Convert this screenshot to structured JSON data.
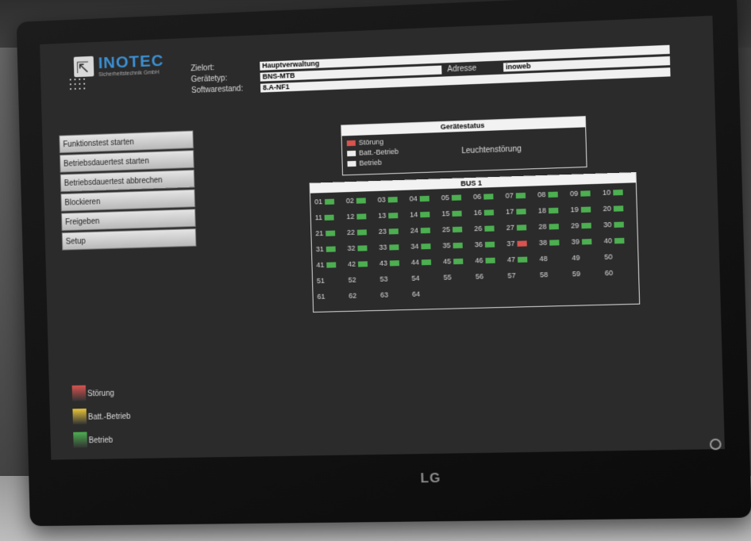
{
  "header": {
    "logo_text": "INOTEC",
    "logo_sub": "Sicherheitstechnik GmbH",
    "zielort_label": "Zielort:",
    "zielort_value": "Hauptverwaltung",
    "geraetetyp_label": "Gerätetyp:",
    "geraetetyp_value": "BNS-MTB",
    "adresse_label": "Adresse",
    "adresse_value": "inoweb",
    "softwarestand_label": "Softwarestand:",
    "softwarestand_value": "8.A-NF1"
  },
  "sidebar": {
    "buttons": [
      "Funktionstest starten",
      "Betriebsdauertest starten",
      "Betriebsdauertest abbrechen",
      "Blockieren",
      "Freigeben",
      "Setup"
    ]
  },
  "status": {
    "title": "Gerätestatus",
    "items": [
      {
        "label": "Störung",
        "color": "#d9534f"
      },
      {
        "label": "Batt.-Betrieb",
        "color": "#eeeeee"
      },
      {
        "label": "Betrieb",
        "color": "#eeeeee"
      }
    ],
    "message": "Leuchtenstörung"
  },
  "bus": {
    "title": "BUS 1",
    "lamps": [
      {
        "label": "01",
        "state": "ok"
      },
      {
        "label": "02",
        "state": "ok"
      },
      {
        "label": "03",
        "state": "ok"
      },
      {
        "label": "04",
        "state": "ok"
      },
      {
        "label": "05",
        "state": "ok"
      },
      {
        "label": "06",
        "state": "ok"
      },
      {
        "label": "07",
        "state": "ok"
      },
      {
        "label": "08",
        "state": "ok"
      },
      {
        "label": "09",
        "state": "ok"
      },
      {
        "label": "10",
        "state": "ok"
      },
      {
        "label": "11",
        "state": "ok"
      },
      {
        "label": "12",
        "state": "ok"
      },
      {
        "label": "13",
        "state": "ok"
      },
      {
        "label": "14",
        "state": "ok"
      },
      {
        "label": "15",
        "state": "ok"
      },
      {
        "label": "16",
        "state": "ok"
      },
      {
        "label": "17",
        "state": "ok"
      },
      {
        "label": "18",
        "state": "ok"
      },
      {
        "label": "19",
        "state": "ok"
      },
      {
        "label": "20",
        "state": "ok"
      },
      {
        "label": "21",
        "state": "ok"
      },
      {
        "label": "22",
        "state": "ok"
      },
      {
        "label": "23",
        "state": "ok"
      },
      {
        "label": "24",
        "state": "ok"
      },
      {
        "label": "25",
        "state": "ok"
      },
      {
        "label": "26",
        "state": "ok"
      },
      {
        "label": "27",
        "state": "ok"
      },
      {
        "label": "28",
        "state": "ok"
      },
      {
        "label": "29",
        "state": "ok"
      },
      {
        "label": "30",
        "state": "ok"
      },
      {
        "label": "31",
        "state": "ok"
      },
      {
        "label": "32",
        "state": "ok"
      },
      {
        "label": "33",
        "state": "ok"
      },
      {
        "label": "34",
        "state": "ok"
      },
      {
        "label": "35",
        "state": "ok"
      },
      {
        "label": "36",
        "state": "ok"
      },
      {
        "label": "37",
        "state": "fault"
      },
      {
        "label": "38",
        "state": "ok"
      },
      {
        "label": "39",
        "state": "ok"
      },
      {
        "label": "40",
        "state": "ok"
      },
      {
        "label": "41",
        "state": "ok"
      },
      {
        "label": "42",
        "state": "ok"
      },
      {
        "label": "43",
        "state": "ok"
      },
      {
        "label": "44",
        "state": "ok"
      },
      {
        "label": "45",
        "state": "ok"
      },
      {
        "label": "46",
        "state": "ok"
      },
      {
        "label": "47",
        "state": "ok"
      },
      {
        "label": "48",
        "state": "none"
      },
      {
        "label": "49",
        "state": "none"
      },
      {
        "label": "50",
        "state": "none"
      },
      {
        "label": "51",
        "state": "none"
      },
      {
        "label": "52",
        "state": "none"
      },
      {
        "label": "53",
        "state": "none"
      },
      {
        "label": "54",
        "state": "none"
      },
      {
        "label": "55",
        "state": "none"
      },
      {
        "label": "56",
        "state": "none"
      },
      {
        "label": "57",
        "state": "none"
      },
      {
        "label": "58",
        "state": "none"
      },
      {
        "label": "59",
        "state": "none"
      },
      {
        "label": "60",
        "state": "none"
      },
      {
        "label": "61",
        "state": "none"
      },
      {
        "label": "62",
        "state": "none"
      },
      {
        "label": "63",
        "state": "none"
      },
      {
        "label": "64",
        "state": "none"
      }
    ]
  },
  "legend": [
    {
      "label": "Störung",
      "color": "#d9534f"
    },
    {
      "label": "Batt.-Betrieb",
      "color": "#e8c43a"
    },
    {
      "label": "Betrieb",
      "color": "#4caf50"
    }
  ],
  "monitor": {
    "brand": "LG"
  },
  "colors": {
    "ok": "#4caf50",
    "fault": "#d9534f"
  }
}
